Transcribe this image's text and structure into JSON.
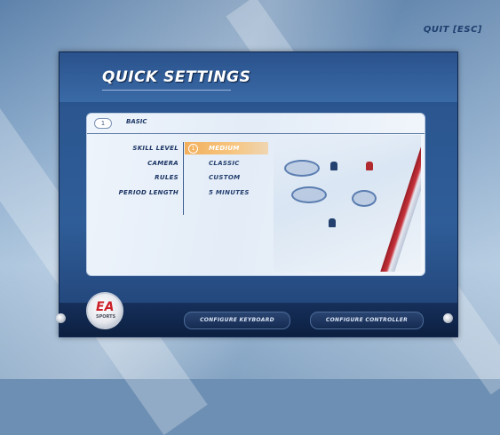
{
  "header": {
    "quit_label": "QUIT [ESC]"
  },
  "screen": {
    "title": "QUICK SETTINGS"
  },
  "tab": {
    "badge": "1",
    "label": "BASIC"
  },
  "settings": [
    {
      "label": "SKILL LEVEL",
      "value": "MEDIUM",
      "selected": true
    },
    {
      "label": "CAMERA",
      "value": "CLASSIC",
      "selected": false
    },
    {
      "label": "RULES",
      "value": "CUSTOM",
      "selected": false
    },
    {
      "label": "PERIOD LENGTH",
      "value": "5 MINUTES",
      "selected": false
    }
  ],
  "highlight_badge": "1",
  "footer": {
    "logo": {
      "mark": "EA",
      "sub": "SPORTS"
    },
    "buttons": [
      "CONFIGURE KEYBOARD",
      "CONFIGURE CONTROLLER"
    ]
  },
  "colors": {
    "accent_orange": "#f3b05c",
    "frame_blue": "#2b5690",
    "panel": "#e3ecf7"
  },
  "icons": [
    "ea-sports-logo-icon",
    "knob-icon"
  ]
}
